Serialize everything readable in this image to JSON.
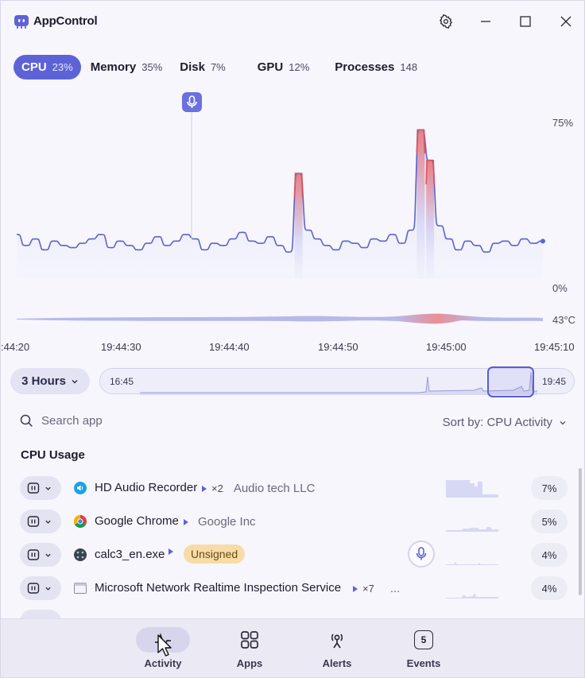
{
  "app": {
    "title": "AppControl"
  },
  "window_controls": {
    "settings": "gear-icon",
    "minimize": "minimize-icon",
    "maximize": "maximize-icon",
    "close": "close-icon"
  },
  "tabs": [
    {
      "label": "CPU",
      "value": "23%"
    },
    {
      "label": "Memory",
      "value": "35%"
    },
    {
      "label": "Disk",
      "value": "7%"
    },
    {
      "label": "GPU",
      "value": "12%"
    },
    {
      "label": "Processes",
      "value": "148"
    }
  ],
  "chart": {
    "y_top_label": "75%",
    "y_bottom_label": "0%",
    "temp_label": "43°C",
    "time_labels": [
      ":44:20",
      "19:44:30",
      "19:44:40",
      "19:44:50",
      "19:45:00",
      "19:45:10"
    ]
  },
  "chart_data": {
    "type": "area",
    "x": [
      "19:44:20",
      "19:44:30",
      "19:44:40",
      "19:44:50",
      "19:45:00",
      "19:45:10"
    ],
    "y_ticks": [
      "75%",
      "0%"
    ],
    "ylim": [
      0,
      75
    ],
    "series": [
      {
        "values": [
          24,
          19,
          22,
          17,
          21,
          19,
          18,
          20,
          22,
          24,
          18,
          21,
          19,
          17,
          20,
          23,
          19,
          21,
          24,
          22,
          17,
          20,
          19,
          22,
          25,
          21,
          20,
          23,
          19,
          16,
          52,
          26,
          22,
          19,
          17,
          21,
          20,
          18,
          22,
          21,
          24,
          20,
          26,
          72,
          58,
          28,
          22,
          17,
          21,
          19,
          16,
          20,
          21,
          19,
          22,
          20,
          21
        ]
      }
    ]
  },
  "range": {
    "selector_label": "3 Hours",
    "start": "16:45",
    "end": "19:45",
    "window_start_fraction": 0.82,
    "window_end_fraction": 0.92
  },
  "search": {
    "placeholder": "Search app"
  },
  "sort": {
    "label": "Sort by: CPU Activity"
  },
  "section": {
    "title": "CPU Usage"
  },
  "processes": [
    {
      "name": "HD Audio Recorder",
      "count": "×2",
      "publisher": "Audio tech LLC",
      "percent": "7%"
    },
    {
      "name": "Google Chrome",
      "publisher": "Google Inc",
      "percent": "5%"
    },
    {
      "name": "calc3_en.exe",
      "badge": "Unsigned",
      "percent": "4%"
    },
    {
      "name": "Microsoft Network Realtime Inspection Service",
      "count": "×7",
      "more": "...",
      "percent": "4%"
    }
  ],
  "nav": [
    {
      "label": "Activity"
    },
    {
      "label": "Apps"
    },
    {
      "label": "Alerts"
    },
    {
      "label": "Events",
      "badge": "5"
    }
  ],
  "colors": {
    "accent": "#5d63d6",
    "peak": "#e0525a",
    "badge_bg": "#f7dca8"
  }
}
